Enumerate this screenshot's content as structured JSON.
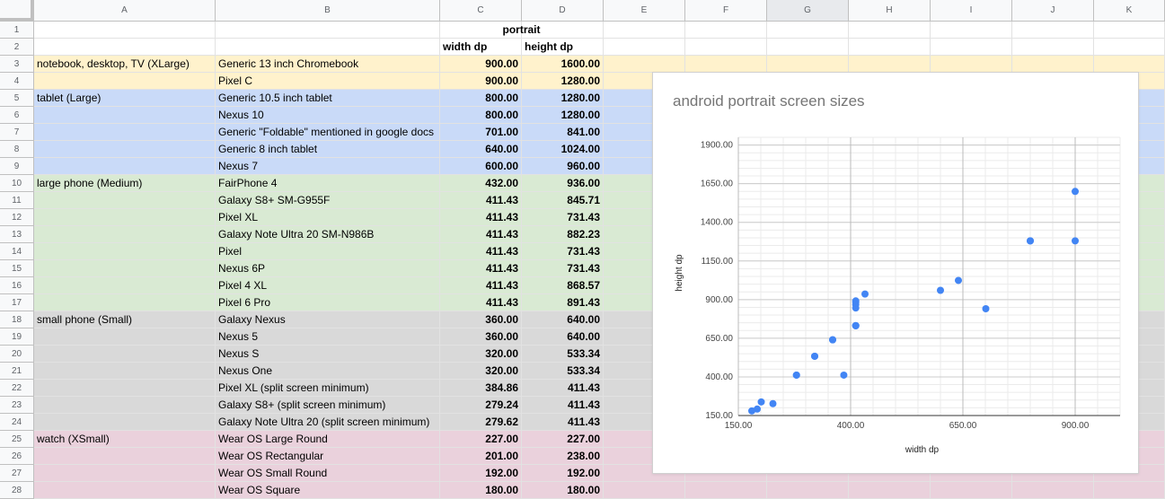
{
  "colors": {
    "XLarge": "#fff2cc",
    "Large": "#c9daf8",
    "Medium": "#d9ead3",
    "Small": "#d9d9d9",
    "XSmall": "#ead1dc"
  },
  "columns": [
    "A",
    "B",
    "C",
    "D",
    "E",
    "F",
    "G",
    "H",
    "I",
    "J",
    "K"
  ],
  "selected_column": "G",
  "header_rows": {
    "r1": {
      "c": "",
      "d": "portrait"
    },
    "r2": {
      "c": "width dp",
      "d": "height dp"
    }
  },
  "rows": [
    {
      "n": "3",
      "group": "notebook, desktop, TV (XLarge)",
      "device": "Generic 13 inch Chromebook",
      "w": "900.00",
      "h": "1600.00",
      "band": "XLarge"
    },
    {
      "n": "4",
      "group": "",
      "device": "Pixel C",
      "w": "900.00",
      "h": "1280.00",
      "band": "XLarge"
    },
    {
      "n": "5",
      "group": "tablet (Large)",
      "device": "Generic 10.5 inch tablet",
      "w": "800.00",
      "h": "1280.00",
      "band": "Large"
    },
    {
      "n": "6",
      "group": "",
      "device": "Nexus 10",
      "w": "800.00",
      "h": "1280.00",
      "band": "Large"
    },
    {
      "n": "7",
      "group": "",
      "device": "Generic \"Foldable\" mentioned in google docs",
      "w": "701.00",
      "h": "841.00",
      "band": "Large"
    },
    {
      "n": "8",
      "group": "",
      "device": "Generic 8 inch tablet",
      "w": "640.00",
      "h": "1024.00",
      "band": "Large"
    },
    {
      "n": "9",
      "group": "",
      "device": "Nexus 7",
      "w": "600.00",
      "h": "960.00",
      "band": "Large"
    },
    {
      "n": "10",
      "group": "large phone (Medium)",
      "device": "FairPhone 4",
      "w": "432.00",
      "h": "936.00",
      "band": "Medium"
    },
    {
      "n": "11",
      "group": "",
      "device": "Galaxy S8+ SM-G955F",
      "w": "411.43",
      "h": "845.71",
      "band": "Medium"
    },
    {
      "n": "12",
      "group": "",
      "device": "Pixel XL",
      "w": "411.43",
      "h": "731.43",
      "band": "Medium"
    },
    {
      "n": "13",
      "group": "",
      "device": "Galaxy Note Ultra 20 SM-N986B",
      "w": "411.43",
      "h": "882.23",
      "band": "Medium"
    },
    {
      "n": "14",
      "group": "",
      "device": "Pixel",
      "w": "411.43",
      "h": "731.43",
      "band": "Medium"
    },
    {
      "n": "15",
      "group": "",
      "device": "Nexus 6P",
      "w": "411.43",
      "h": "731.43",
      "band": "Medium"
    },
    {
      "n": "16",
      "group": "",
      "device": "Pixel 4 XL",
      "w": "411.43",
      "h": "868.57",
      "band": "Medium"
    },
    {
      "n": "17",
      "group": "",
      "device": "Pixel 6 Pro",
      "w": "411.43",
      "h": "891.43",
      "band": "Medium"
    },
    {
      "n": "18",
      "group": "small phone (Small)",
      "device": "Galaxy Nexus",
      "w": "360.00",
      "h": "640.00",
      "band": "Small"
    },
    {
      "n": "19",
      "group": "",
      "device": "Nexus 5",
      "w": "360.00",
      "h": "640.00",
      "band": "Small"
    },
    {
      "n": "20",
      "group": "",
      "device": "Nexus S",
      "w": "320.00",
      "h": "533.34",
      "band": "Small"
    },
    {
      "n": "21",
      "group": "",
      "device": "Nexus One",
      "w": "320.00",
      "h": "533.34",
      "band": "Small"
    },
    {
      "n": "22",
      "group": "",
      "device": "Pixel XL (split screen minimum)",
      "w": "384.86",
      "h": "411.43",
      "band": "Small"
    },
    {
      "n": "23",
      "group": "",
      "device": "Galaxy S8+ (split screen minimum)",
      "w": "279.24",
      "h": "411.43",
      "band": "Small"
    },
    {
      "n": "24",
      "group": "",
      "device": "Galaxy Note Ultra 20 (split screen minimum)",
      "w": "279.62",
      "h": "411.43",
      "band": "Small"
    },
    {
      "n": "25",
      "group": "watch (XSmall)",
      "device": "Wear OS Large Round",
      "w": "227.00",
      "h": "227.00",
      "band": "XSmall"
    },
    {
      "n": "26",
      "group": "",
      "device": "Wear OS Rectangular",
      "w": "201.00",
      "h": "238.00",
      "band": "XSmall"
    },
    {
      "n": "27",
      "group": "",
      "device": "Wear OS Small Round",
      "w": "192.00",
      "h": "192.00",
      "band": "XSmall"
    },
    {
      "n": "28",
      "group": "",
      "device": "Wear OS Square",
      "w": "180.00",
      "h": "180.00",
      "band": "XSmall"
    }
  ],
  "chart_data": {
    "type": "scatter",
    "title": "android portrait screen sizes",
    "xlabel": "width dp",
    "ylabel": "height dp",
    "xlim": [
      150,
      1000
    ],
    "ylim": [
      150,
      1950
    ],
    "x_ticks": [
      "150.00",
      "400.00",
      "650.00",
      "900.00"
    ],
    "y_ticks": [
      "150.00",
      "400.00",
      "650.00",
      "900.00",
      "1150.00",
      "1400.00",
      "1650.00",
      "1900.00"
    ],
    "grid": true,
    "point_color": "#4285f4",
    "x": [
      900,
      900,
      800,
      800,
      701,
      640,
      600,
      432,
      411.43,
      411.43,
      411.43,
      411.43,
      411.43,
      411.43,
      411.43,
      360,
      360,
      320,
      320,
      384.86,
      279.24,
      279.62,
      227,
      201,
      192,
      180
    ],
    "y": [
      1600,
      1280,
      1280,
      1280,
      841,
      1024,
      960,
      936,
      845.71,
      731.43,
      882.23,
      731.43,
      731.43,
      868.57,
      891.43,
      640,
      640,
      533.34,
      533.34,
      411.43,
      411.43,
      411.43,
      227,
      238,
      192,
      180
    ]
  }
}
